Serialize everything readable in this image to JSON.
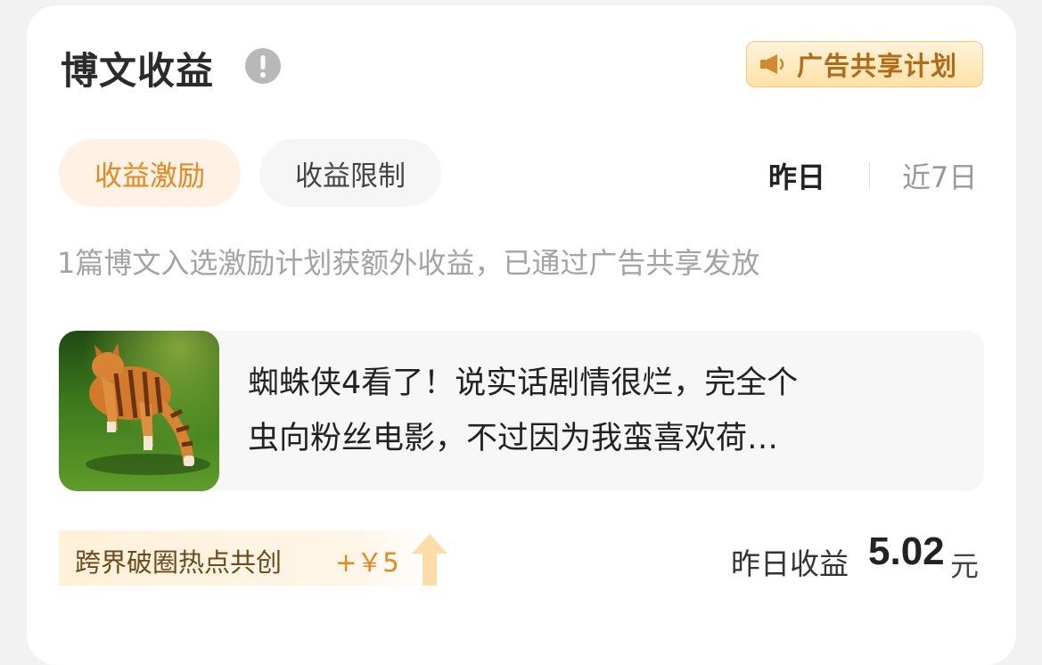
{
  "header": {
    "title": "博文收益",
    "ad_badge_label": "广告共享计划"
  },
  "tabs": [
    {
      "label": "收益激励",
      "active": true
    },
    {
      "label": "收益限制",
      "active": false
    }
  ],
  "time_range": {
    "options": [
      "昨日",
      "近7日"
    ],
    "selected": "昨日"
  },
  "description": "1篇博文入选激励计划获额外收益，已通过广告共享发放",
  "post": {
    "text_line1": "蜘蛛侠4看了！说实话剧情很烂，完全个",
    "text_line2": "虫向粉丝电影，不过因为我蛮喜欢荷…"
  },
  "reward": {
    "label": "跨界破圈热点共创",
    "amount": "+￥5"
  },
  "earnings": {
    "label": "昨日收益",
    "value": "5.02",
    "unit": "元"
  },
  "colors": {
    "accent": "#e8871e",
    "badge_text": "#b36a16"
  },
  "icons": {
    "info": "exclamation-circle-icon",
    "ad": "megaphone-icon",
    "reward": "up-arrow-icon"
  }
}
